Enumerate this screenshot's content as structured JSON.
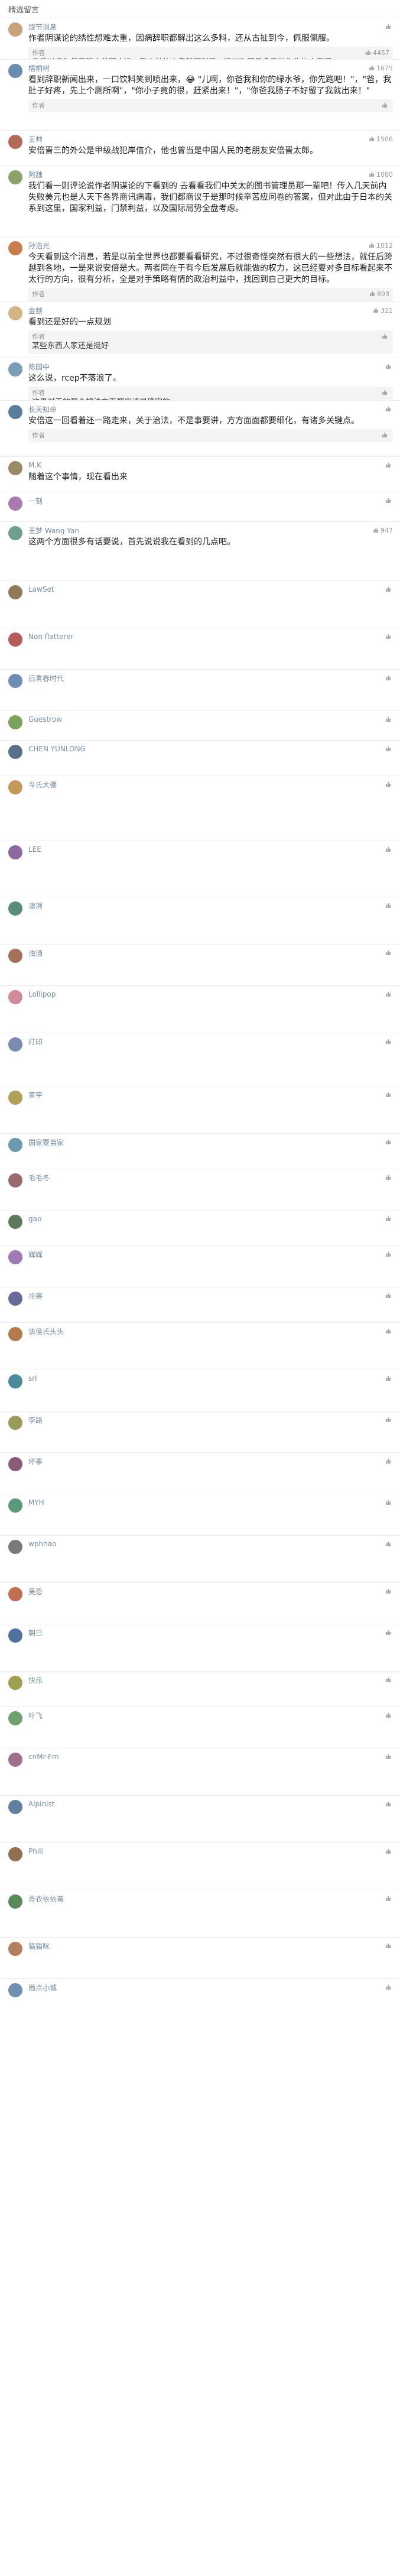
{
  "header": {
    "title": "精选留言"
  },
  "comments": [
    {
      "user": "旋节消息",
      "likes": "",
      "text": "作者阴谋论的绣性想难太重，因病辞职都解出这么多料，还从古扯到今，佩服佩服。",
      "reply_label": "作者",
      "reply_likes": "4457",
      "reply_text": "安倍以病为借口辞去美国大选，我之前的文章就预判了，建议你还是多看些头头的文章吧",
      "color": "#c8a27a"
    },
    {
      "user": "梧桐树",
      "likes": "1675",
      "text": "看到辞职新闻出来，一口饮料笑到喷出来，😂 \"儿啊，你爸我和你的绿水爷，你先跑吧！\"，\"爸，我肚子好疼，先上个厕所啊\"，\"你小子竟的很，赶紧出来！\"，\"你爸我肠子不好留了我就出来！\"",
      "reply_label": "作者",
      "reply_likes": "",
      "reply_text": "",
      "color": "#6a8caf"
    },
    {
      "user": "王帅",
      "likes": "1506",
      "text": "安倍晋三的外公是甲级战犯岸信介，他也曾当是中国人民的老朋友安倍晋太郎。",
      "reply_label": "",
      "reply_likes": "",
      "reply_text": "",
      "color": "#b46a5a"
    },
    {
      "user": "阿魏",
      "likes": "1080",
      "text": "我们看一则评论说作者阴谋论的下看到的 去看看我们中关太的图书管理员那一辈吧！传入几天前内失败美元也是人天下各界商讯病毒，我们都商议于是那时候辛苦应问卷的答案，但对此由于日本的关系到这里，国家利益，门禁利益，以及国际局势全盘考虑。",
      "reply_label": "",
      "reply_likes": "",
      "reply_text": "",
      "color": "#8aa36a"
    },
    {
      "user": "孙浩光",
      "likes": "1012",
      "text": "今天看到这个消息，若是以前全世界也都要看看研究，不过很奇怪突然有很大的一些想法，就任后跨越到各地，一是来说安倍是大。两者同在于有今后发展后就能做的权力，这已经要对多目标看起来不太行的方向，很有分析，全是对手策略有情的政治利益中，找回到自己更大的目标。",
      "reply_label": "作者",
      "reply_likes": "893",
      "reply_text": "",
      "color": "#c97d4e"
    },
    {
      "user": "金额",
      "likes": "321",
      "text": "看到还是好的一点规划",
      "reply_label": "作者",
      "reply_likes": "",
      "reply_text": "某些东西人家还是挺好",
      "color": "#d4b483"
    },
    {
      "user": "陈国中",
      "likes": "",
      "text": "这么说，rcep不落浪了。",
      "reply_label": "作者",
      "reply_likes": "",
      "reply_text": "这里对于的那个想法方面都应该是确定的",
      "color": "#7b9eb8"
    },
    {
      "user": "长天知命",
      "likes": "",
      "text": "安倍这一回看着还一路走来，关于治法，不是事要讲，方方面面都要细化，有诸多关键点。",
      "reply_label": "作者",
      "reply_likes": "",
      "reply_text": "",
      "color": "#5a7d9a"
    },
    {
      "user": "M.K",
      "likes": "",
      "text": "随着这个事情，现在看出来",
      "reply_label": "",
      "reply_likes": "",
      "reply_text": "",
      "color": "#9a8a6a"
    },
    {
      "user": "一刻",
      "likes": "",
      "text": "",
      "reply_label": "",
      "reply_likes": "",
      "reply_text": "",
      "color": "#a87ab0"
    },
    {
      "user": "王梦 Wang Yan",
      "likes": "947",
      "text": "这两个方面很多有话要说，首先说说我在看到的几点吧。",
      "reply_label": "",
      "reply_likes": "",
      "reply_text": "",
      "color": "#6e9f8f"
    },
    {
      "user": "LawSet",
      "likes": "",
      "text": "",
      "reply_label": "",
      "reply_likes": "",
      "reply_text": "",
      "color": "#8f7a5c"
    },
    {
      "user": "Non flatterer",
      "likes": "",
      "text": "",
      "reply_label": "",
      "reply_likes": "",
      "reply_text": "",
      "color": "#b55d5d"
    },
    {
      "user": "后青春时代",
      "likes": "",
      "text": "",
      "reply_label": "",
      "reply_likes": "",
      "reply_text": "",
      "color": "#6c8eb5"
    },
    {
      "user": "Guestrow",
      "likes": "",
      "text": "",
      "reply_label": "",
      "reply_likes": "",
      "reply_text": "",
      "color": "#7aa35e"
    },
    {
      "user": "CHEN YUNLONG",
      "likes": "",
      "text": "",
      "reply_label": "",
      "reply_likes": "",
      "reply_text": "",
      "color": "#5b6f8a"
    },
    {
      "user": "今氏大棚",
      "likes": "",
      "text": "",
      "reply_label": "",
      "reply_likes": "",
      "reply_text": "",
      "color": "#c49a5a"
    },
    {
      "user": "LEE",
      "likes": "",
      "text": "",
      "reply_label": "",
      "reply_likes": "",
      "reply_text": "",
      "color": "#8a6a9f"
    },
    {
      "user": "凛冽",
      "likes": "",
      "text": "",
      "reply_label": "",
      "reply_likes": "",
      "reply_text": "",
      "color": "#5a8a7a"
    },
    {
      "user": "浊酒",
      "likes": "",
      "text": "",
      "reply_label": "",
      "reply_likes": "",
      "reply_text": "",
      "color": "#a5705a"
    },
    {
      "user": "Lollipop",
      "likes": "",
      "text": "",
      "reply_label": "",
      "reply_likes": "",
      "reply_text": "",
      "color": "#d08a9a"
    },
    {
      "user": "打印",
      "likes": "",
      "text": "",
      "reply_label": "",
      "reply_likes": "",
      "reply_text": "",
      "color": "#7a8ab0"
    },
    {
      "user": "黄宇",
      "likes": "",
      "text": "",
      "reply_label": "",
      "reply_likes": "",
      "reply_text": "",
      "color": "#b0a05a"
    },
    {
      "user": "国家要自家",
      "likes": "",
      "text": "",
      "reply_label": "",
      "reply_likes": "",
      "reply_text": "",
      "color": "#6a9ab0"
    },
    {
      "user": "毛毛冬",
      "likes": "",
      "text": "",
      "reply_label": "",
      "reply_likes": "",
      "reply_text": "",
      "color": "#9a6a6a"
    },
    {
      "user": "gao",
      "likes": "",
      "text": "",
      "reply_label": "",
      "reply_likes": "",
      "reply_text": "",
      "color": "#5a7a5a"
    },
    {
      "user": "辉辉",
      "likes": "",
      "text": "",
      "reply_label": "",
      "reply_likes": "",
      "reply_text": "",
      "color": "#a07ab5"
    },
    {
      "user": "冷寒",
      "likes": "",
      "text": "",
      "reply_label": "",
      "reply_likes": "",
      "reply_text": "",
      "color": "#6a6a9a"
    },
    {
      "user": "该侯氏头头",
      "likes": "",
      "text": "",
      "reply_label": "",
      "reply_likes": "",
      "reply_text": "",
      "color": "#b57a4a"
    },
    {
      "user": "srl",
      "likes": "",
      "text": "",
      "reply_label": "",
      "reply_likes": "",
      "reply_text": "",
      "color": "#4a8a9a"
    },
    {
      "user": "李路",
      "likes": "",
      "text": "",
      "reply_label": "",
      "reply_likes": "",
      "reply_text": "",
      "color": "#9a9a5a"
    },
    {
      "user": "坏事",
      "likes": "",
      "text": "",
      "reply_label": "",
      "reply_likes": "",
      "reply_text": "",
      "color": "#8a5a7a"
    },
    {
      "user": "MYH",
      "likes": "",
      "text": "",
      "reply_label": "",
      "reply_likes": "",
      "reply_text": "",
      "color": "#5a9a7a"
    },
    {
      "user": "wphhao",
      "likes": "",
      "text": "",
      "reply_label": "",
      "reply_likes": "",
      "reply_text": "",
      "color": "#7a7a7a"
    },
    {
      "user": "吴恐",
      "likes": "",
      "text": "",
      "reply_label": "",
      "reply_likes": "",
      "reply_text": "",
      "color": "#c07050"
    },
    {
      "user": "朝日",
      "likes": "",
      "text": "",
      "reply_label": "",
      "reply_likes": "",
      "reply_text": "",
      "color": "#5070a0"
    },
    {
      "user": "快乐",
      "likes": "",
      "text": "",
      "reply_label": "",
      "reply_likes": "",
      "reply_text": "",
      "color": "#a0a050"
    },
    {
      "user": "叶飞",
      "likes": "",
      "text": "",
      "reply_label": "",
      "reply_likes": "",
      "reply_text": "",
      "color": "#70a070"
    },
    {
      "user": "cnMr-Fm",
      "likes": "",
      "text": "",
      "reply_label": "",
      "reply_likes": "",
      "reply_text": "",
      "color": "#a07090"
    },
    {
      "user": "Alpinist",
      "likes": "",
      "text": "",
      "reply_label": "",
      "reply_likes": "",
      "reply_text": "",
      "color": "#6080a0"
    },
    {
      "user": "Phill",
      "likes": "",
      "text": "",
      "reply_label": "",
      "reply_likes": "",
      "reply_text": "",
      "color": "#907050"
    },
    {
      "user": "青衣依依者",
      "likes": "",
      "text": "",
      "reply_label": "",
      "reply_likes": "",
      "reply_text": "",
      "color": "#5a8a5a"
    },
    {
      "user": "猫猫咪",
      "likes": "",
      "text": "",
      "reply_label": "",
      "reply_likes": "",
      "reply_text": "",
      "color": "#b08060"
    },
    {
      "user": "雨点小城",
      "likes": "",
      "text": "",
      "reply_label": "",
      "reply_likes": "",
      "reply_text": "",
      "color": "#7090b0"
    }
  ]
}
